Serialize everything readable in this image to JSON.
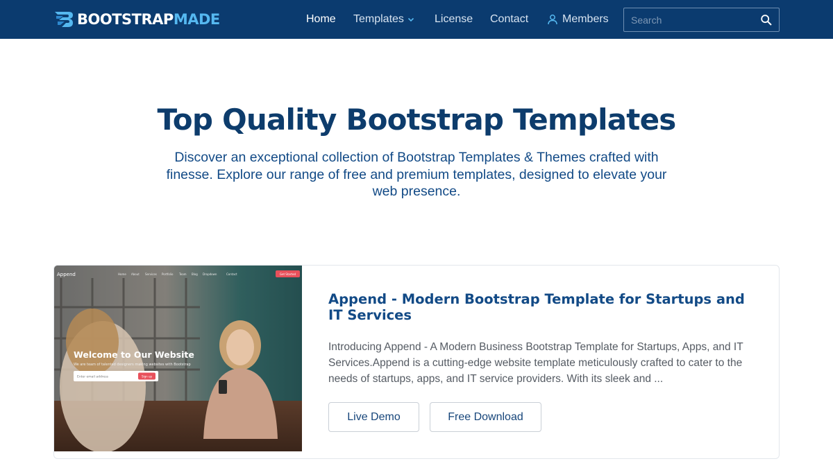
{
  "header": {
    "logo_primary": "BOOTSTRAP",
    "logo_secondary": "MADE",
    "nav": {
      "home": "Home",
      "templates": "Templates",
      "license": "License",
      "contact": "Contact",
      "members": "Members"
    },
    "search_placeholder": "Search",
    "colors": {
      "bar": "#0b3b6f",
      "logo_accent": "#55b8f0"
    }
  },
  "hero": {
    "title": "Top Quality Bootstrap Templates",
    "subtitle": "Discover an exceptional collection of Bootstrap Templates & Themes crafted with finesse. Explore our range of free and premium templates, designed to elevate your web presence."
  },
  "template_card": {
    "title": "Append - Modern Bootstrap Template for Startups and IT Services",
    "description": "Introducing Append - A Modern Business Bootstrap Template for Startups, Apps, and IT Services.Append is a cutting-edge website template meticulously crafted to cater to the needs of startups, apps, and IT service providers. With its sleek and ...",
    "live_demo_label": "Live Demo",
    "free_download_label": "Free Download",
    "preview": {
      "brand": "Append",
      "menu": [
        "Home",
        "About",
        "Services",
        "Portfolio",
        "Team",
        "Blog",
        "Dropdown",
        "Contact"
      ],
      "cta": "Get Started",
      "headline": "Welcome to Our Website",
      "tagline": "We are team of talented designers making websites with Bootstrap",
      "email_placeholder": "Enter email address",
      "signup": "Sign up"
    }
  }
}
